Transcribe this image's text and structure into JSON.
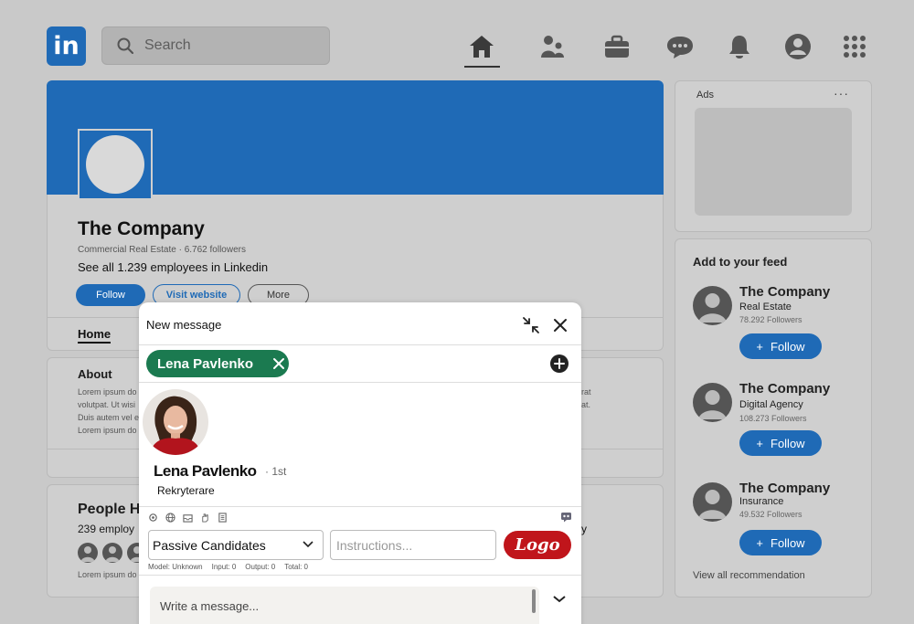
{
  "nav": {
    "logo_text": "in",
    "search_placeholder": "Search",
    "icons": [
      "home-icon",
      "people-icon",
      "briefcase-icon",
      "chat-icon",
      "bell-icon",
      "profile-icon",
      "grid-icon"
    ]
  },
  "company": {
    "name": "The Company",
    "subtitle": "Commercial Real Estate · 6.762 followers",
    "employees": "See all 1.239 employees in Linkedin",
    "follow_label": "Follow",
    "visit_label": "Visit website",
    "more_label": "More",
    "tab_home": "Home",
    "about_title": "About",
    "about_lines_left": [
      "Lorem ipsum do",
      "volutpat. Ut wisi",
      "Duis autem vel e",
      "Lorem ipsum do"
    ],
    "about_lines_right": [
      "rat",
      "at."
    ],
    "people_title": "People Hi",
    "people_sub": "239 employ",
    "people_footer": "Lorem ipsum do",
    "people_right_fragment": "y"
  },
  "ads": {
    "label": "Ads",
    "dots": "···"
  },
  "feed": {
    "title": "Add to your feed",
    "items": [
      {
        "name": "The Company",
        "category": "Real Estate",
        "followers": "78.292 Followers",
        "button": "Follow"
      },
      {
        "name": "The Company",
        "category": "Digital Agency",
        "followers": "108.273 Followers",
        "button": "Follow"
      },
      {
        "name": "The Company",
        "category": "Insurance",
        "followers": "49.532 Followers",
        "button": "Follow"
      }
    ],
    "view_all": "View all recommendation"
  },
  "message": {
    "title": "New message",
    "recipient_chip": "Lena Pavlenko",
    "profile_name": "Lena Pavlenko",
    "degree": "· 1st",
    "role": "Rekryterare",
    "select_value": "Passive Candidates",
    "instructions_placeholder": "Instructions...",
    "logo_button": "Logo",
    "stats": {
      "model": "Model: Unknown",
      "input": "Input: 0",
      "output": "Output: 0",
      "total": "Total: 0"
    },
    "compose_placeholder": "Write a message..."
  },
  "colors": {
    "brand_blue": "#1f6ab6",
    "chip_green": "#1b7a50",
    "logo_red": "#c0151b",
    "background": "#c9c9c9"
  }
}
